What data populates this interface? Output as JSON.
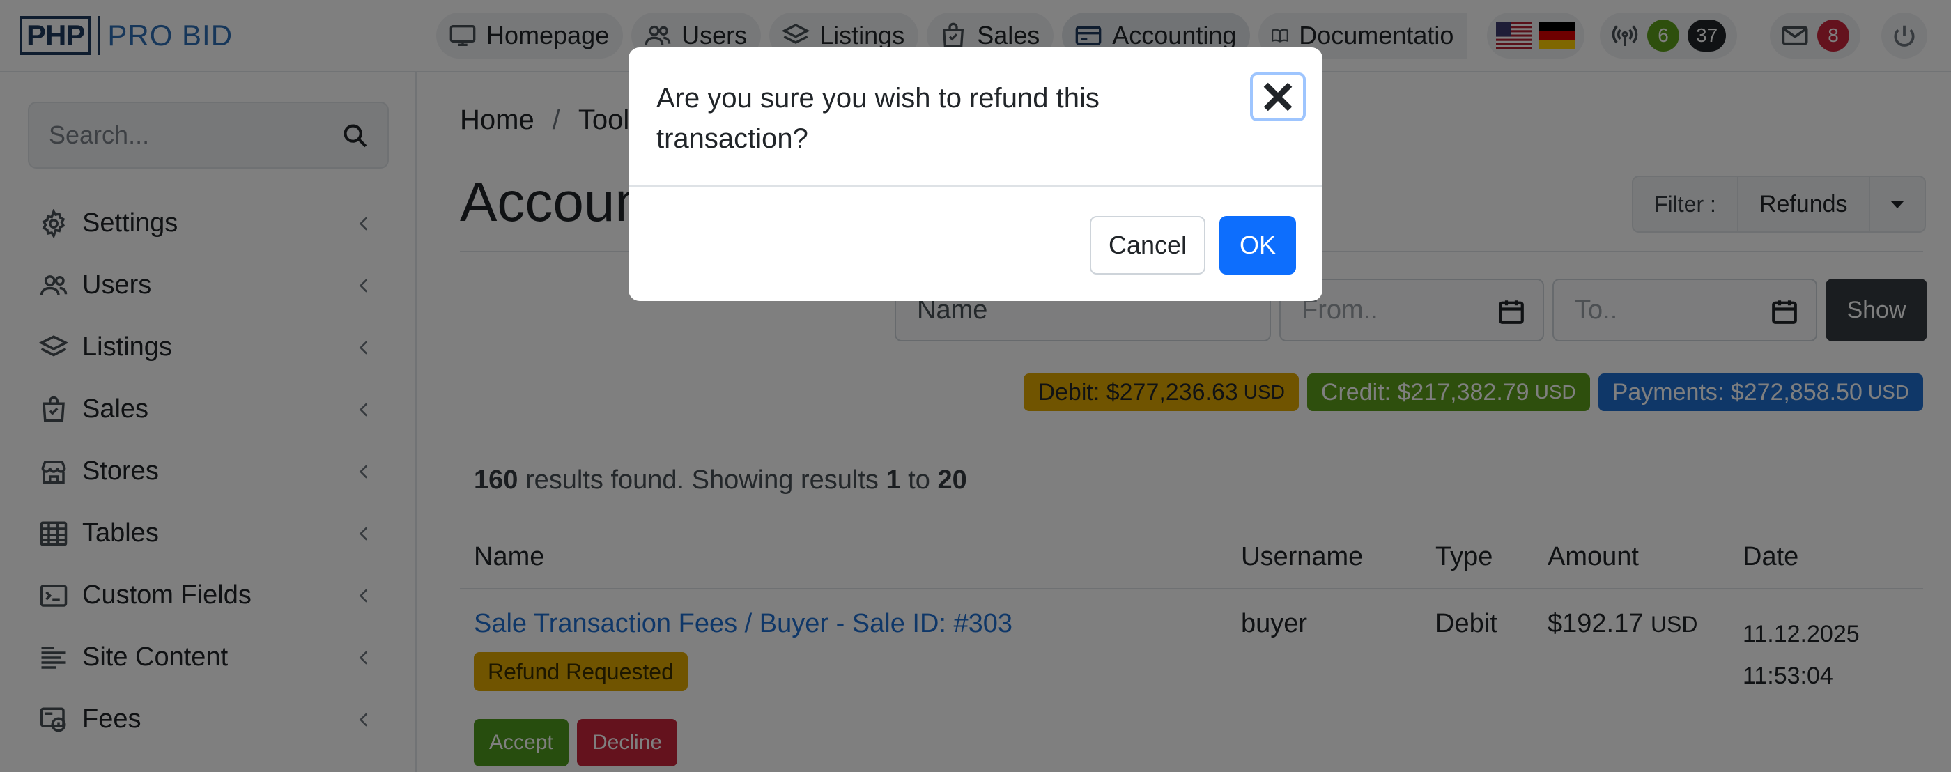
{
  "logo": {
    "mark": "PHP",
    "text": "PRO BID"
  },
  "nav": {
    "items": [
      {
        "label": "Homepage",
        "icon": "monitor-icon"
      },
      {
        "label": "Users",
        "icon": "users-icon"
      },
      {
        "label": "Listings",
        "icon": "layers-icon"
      },
      {
        "label": "Sales",
        "icon": "shopping-bag-icon"
      },
      {
        "label": "Accounting",
        "icon": "credit-card-icon"
      },
      {
        "label": "Documentatio",
        "icon": "book-icon"
      }
    ],
    "online_count": "6",
    "online_total": "37",
    "messages_count": "8"
  },
  "sidebar": {
    "search_placeholder": "Search...",
    "items": [
      {
        "label": "Settings",
        "icon": "gear-icon"
      },
      {
        "label": "Users",
        "icon": "users-icon"
      },
      {
        "label": "Listings",
        "icon": "layers-icon"
      },
      {
        "label": "Sales",
        "icon": "shopping-bag-icon"
      },
      {
        "label": "Stores",
        "icon": "store-icon"
      },
      {
        "label": "Tables",
        "icon": "table-icon"
      },
      {
        "label": "Custom Fields",
        "icon": "terminal-icon"
      },
      {
        "label": "Site Content",
        "icon": "text-lines-icon"
      },
      {
        "label": "Fees",
        "icon": "fees-icon"
      }
    ]
  },
  "main": {
    "breadcrumb": [
      "Home",
      "/",
      "Tools"
    ],
    "title": "Accounting",
    "filter": {
      "label": "Filter :",
      "value": "Refunds"
    },
    "search": {
      "name_placeholder": "Name",
      "from_placeholder": "From..",
      "to_placeholder": "To..",
      "show_label": "Show"
    },
    "totals": {
      "debit_label": "Debit: $277,236.63",
      "debit_currency": "USD",
      "credit_label": "Credit: $217,382.79",
      "credit_currency": "USD",
      "payments_label": "Payments: $272,858.50",
      "payments_currency": "USD"
    },
    "results": {
      "count": "160",
      "text1": "results found. Showing results",
      "from": "1",
      "to_word": "to",
      "to": "20"
    },
    "table": {
      "headers": [
        "Name",
        "Username",
        "Type",
        "Amount",
        "Date"
      ],
      "row": {
        "name": "Sale Transaction Fees / Buyer - Sale ID: #303",
        "status": "Refund Requested",
        "username": "buyer",
        "type": "Debit",
        "amount": "$192.17",
        "currency": "USD",
        "date": "11.12.2025",
        "time": "11:53:04",
        "accept_label": "Accept",
        "decline_label": "Decline"
      }
    }
  },
  "modal": {
    "message": "Are you sure you wish to refund this transaction?",
    "cancel_label": "Cancel",
    "ok_label": "OK"
  },
  "colors": {
    "primary": "#0d6efd",
    "warning": "#e0a800",
    "success": "#5c9e1a",
    "danger": "#c8243b",
    "dark": "#343a40"
  }
}
